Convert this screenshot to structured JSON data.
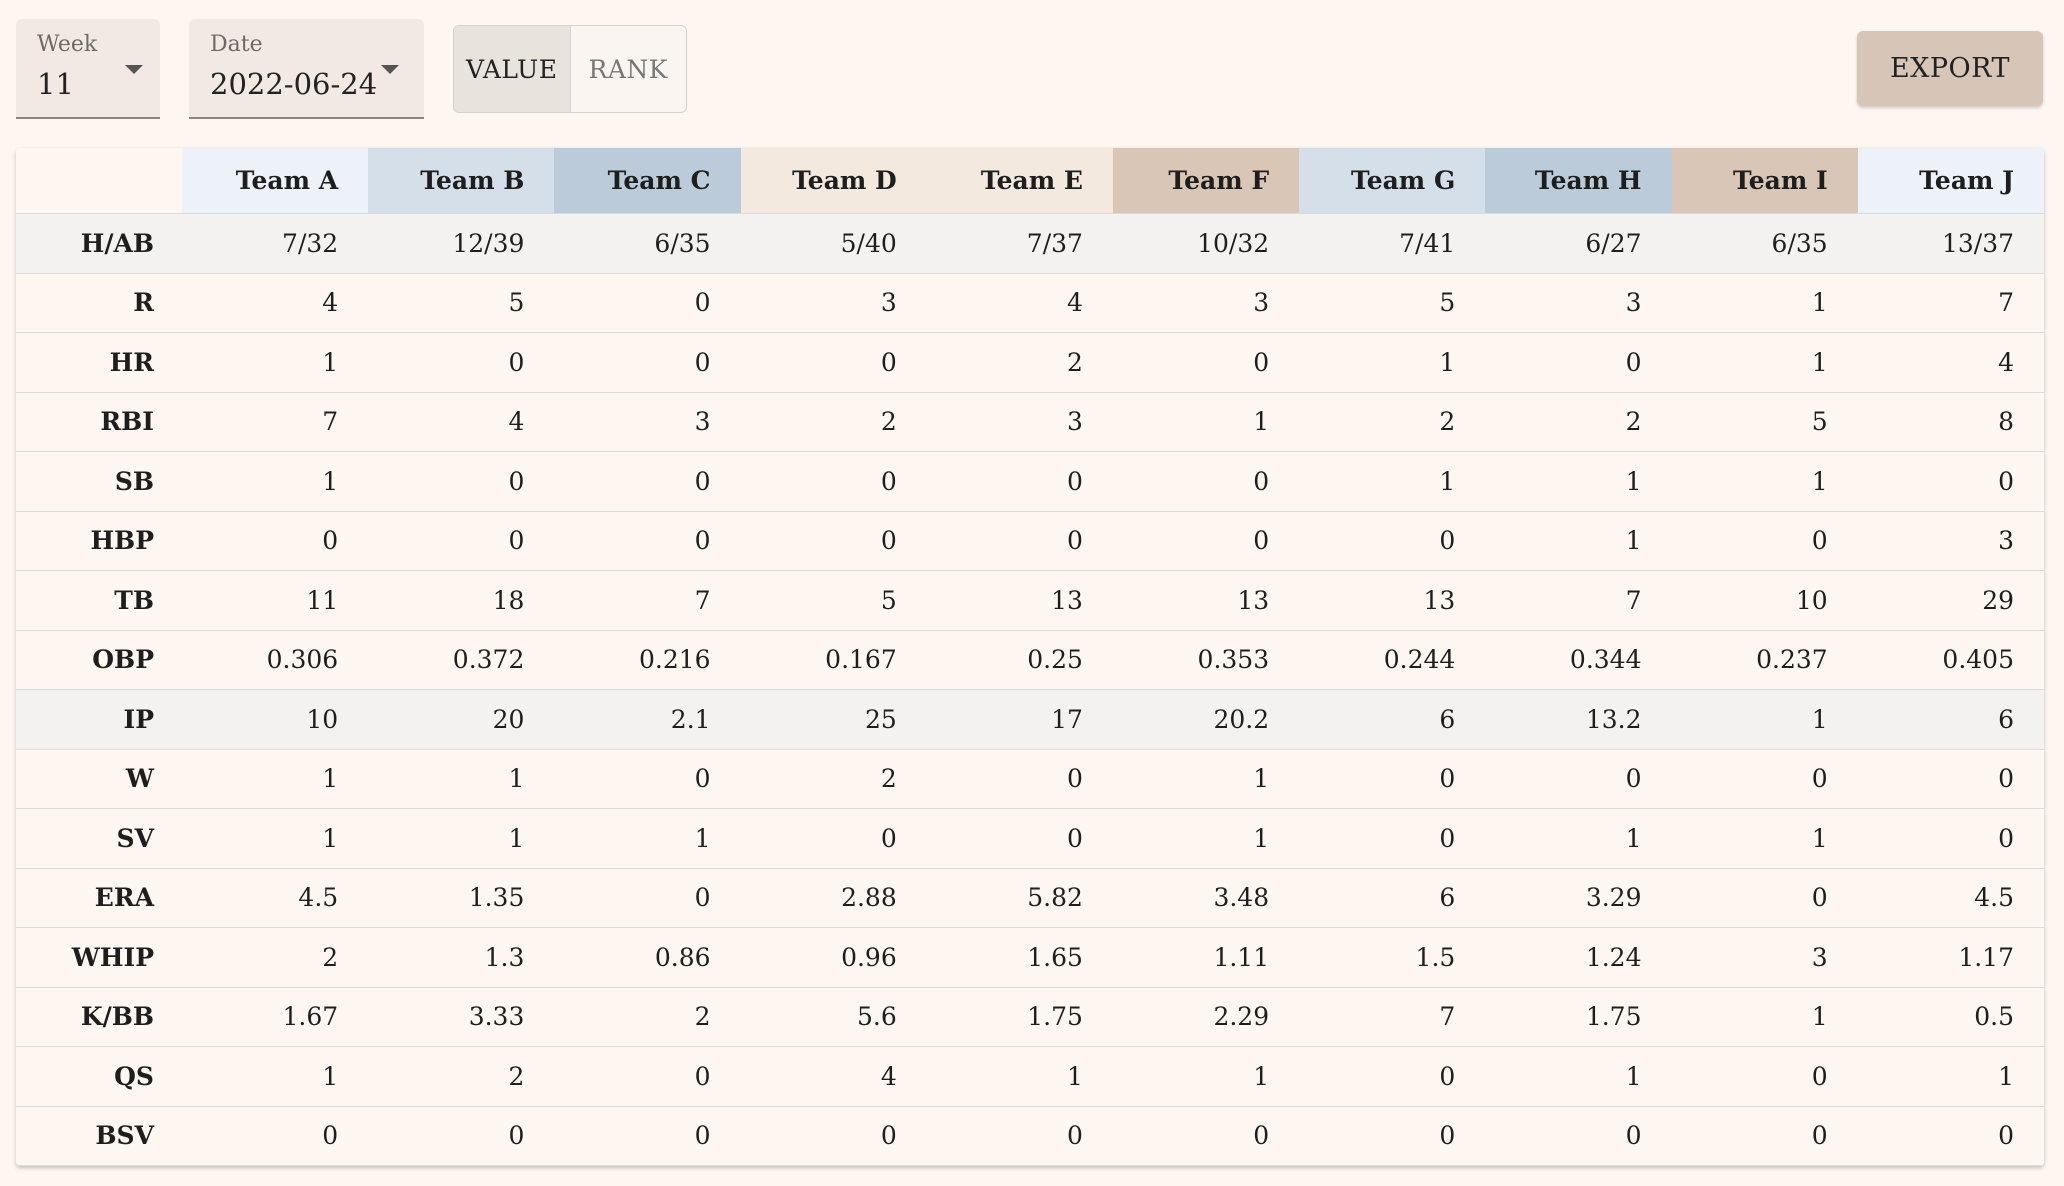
{
  "filters": {
    "week": {
      "label": "Week",
      "value": "11"
    },
    "date": {
      "label": "Date",
      "value": "2022-06-24"
    }
  },
  "view_toggle": {
    "value_label": "VALUE",
    "rank_label": "RANK",
    "selected": "VALUE"
  },
  "export_label": "EXPORT",
  "colors": {
    "header_light_blue": "#edf1f8",
    "header_blue": "#d4dfea",
    "header_steel": "#bccbda",
    "header_cream": "#f3e9df",
    "header_tan": "#d9c6b7",
    "shaded_row": "#f3f2f1"
  },
  "table": {
    "columns": [
      {
        "name": "Team A",
        "color": "#edf1f8"
      },
      {
        "name": "Team B",
        "color": "#d4dfea"
      },
      {
        "name": "Team C",
        "color": "#bccbda"
      },
      {
        "name": "Team D",
        "color": "#f3e9df"
      },
      {
        "name": "Team E",
        "color": "#f3e9df"
      },
      {
        "name": "Team F",
        "color": "#d9c6b7"
      },
      {
        "name": "Team G",
        "color": "#d4dfea"
      },
      {
        "name": "Team H",
        "color": "#bccbda"
      },
      {
        "name": "Team I",
        "color": "#d9c6b7"
      },
      {
        "name": "Team J",
        "color": "#edf1f8"
      }
    ],
    "rows": [
      {
        "stat": "H/AB",
        "shaded": true,
        "values": [
          "7/32",
          "12/39",
          "6/35",
          "5/40",
          "7/37",
          "10/32",
          "7/41",
          "6/27",
          "6/35",
          "13/37"
        ]
      },
      {
        "stat": "R",
        "shaded": false,
        "values": [
          "4",
          "5",
          "0",
          "3",
          "4",
          "3",
          "5",
          "3",
          "1",
          "7"
        ]
      },
      {
        "stat": "HR",
        "shaded": false,
        "values": [
          "1",
          "0",
          "0",
          "0",
          "2",
          "0",
          "1",
          "0",
          "1",
          "4"
        ]
      },
      {
        "stat": "RBI",
        "shaded": false,
        "values": [
          "7",
          "4",
          "3",
          "2",
          "3",
          "1",
          "2",
          "2",
          "5",
          "8"
        ]
      },
      {
        "stat": "SB",
        "shaded": false,
        "values": [
          "1",
          "0",
          "0",
          "0",
          "0",
          "0",
          "1",
          "1",
          "1",
          "0"
        ]
      },
      {
        "stat": "HBP",
        "shaded": false,
        "values": [
          "0",
          "0",
          "0",
          "0",
          "0",
          "0",
          "0",
          "1",
          "0",
          "3"
        ]
      },
      {
        "stat": "TB",
        "shaded": false,
        "values": [
          "11",
          "18",
          "7",
          "5",
          "13",
          "13",
          "13",
          "7",
          "10",
          "29"
        ]
      },
      {
        "stat": "OBP",
        "shaded": false,
        "values": [
          "0.306",
          "0.372",
          "0.216",
          "0.167",
          "0.25",
          "0.353",
          "0.244",
          "0.344",
          "0.237",
          "0.405"
        ]
      },
      {
        "stat": "IP",
        "shaded": true,
        "values": [
          "10",
          "20",
          "2.1",
          "25",
          "17",
          "20.2",
          "6",
          "13.2",
          "1",
          "6"
        ]
      },
      {
        "stat": "W",
        "shaded": false,
        "values": [
          "1",
          "1",
          "0",
          "2",
          "0",
          "1",
          "0",
          "0",
          "0",
          "0"
        ]
      },
      {
        "stat": "SV",
        "shaded": false,
        "values": [
          "1",
          "1",
          "1",
          "0",
          "0",
          "1",
          "0",
          "1",
          "1",
          "0"
        ]
      },
      {
        "stat": "ERA",
        "shaded": false,
        "values": [
          "4.5",
          "1.35",
          "0",
          "2.88",
          "5.82",
          "3.48",
          "6",
          "3.29",
          "0",
          "4.5"
        ]
      },
      {
        "stat": "WHIP",
        "shaded": false,
        "values": [
          "2",
          "1.3",
          "0.86",
          "0.96",
          "1.65",
          "1.11",
          "1.5",
          "1.24",
          "3",
          "1.17"
        ]
      },
      {
        "stat": "K/BB",
        "shaded": false,
        "values": [
          "1.67",
          "3.33",
          "2",
          "5.6",
          "1.75",
          "2.29",
          "7",
          "1.75",
          "1",
          "0.5"
        ]
      },
      {
        "stat": "QS",
        "shaded": false,
        "values": [
          "1",
          "2",
          "0",
          "4",
          "1",
          "1",
          "0",
          "1",
          "0",
          "1"
        ]
      },
      {
        "stat": "BSV",
        "shaded": false,
        "values": [
          "0",
          "0",
          "0",
          "0",
          "0",
          "0",
          "0",
          "0",
          "0",
          "0"
        ]
      }
    ]
  }
}
